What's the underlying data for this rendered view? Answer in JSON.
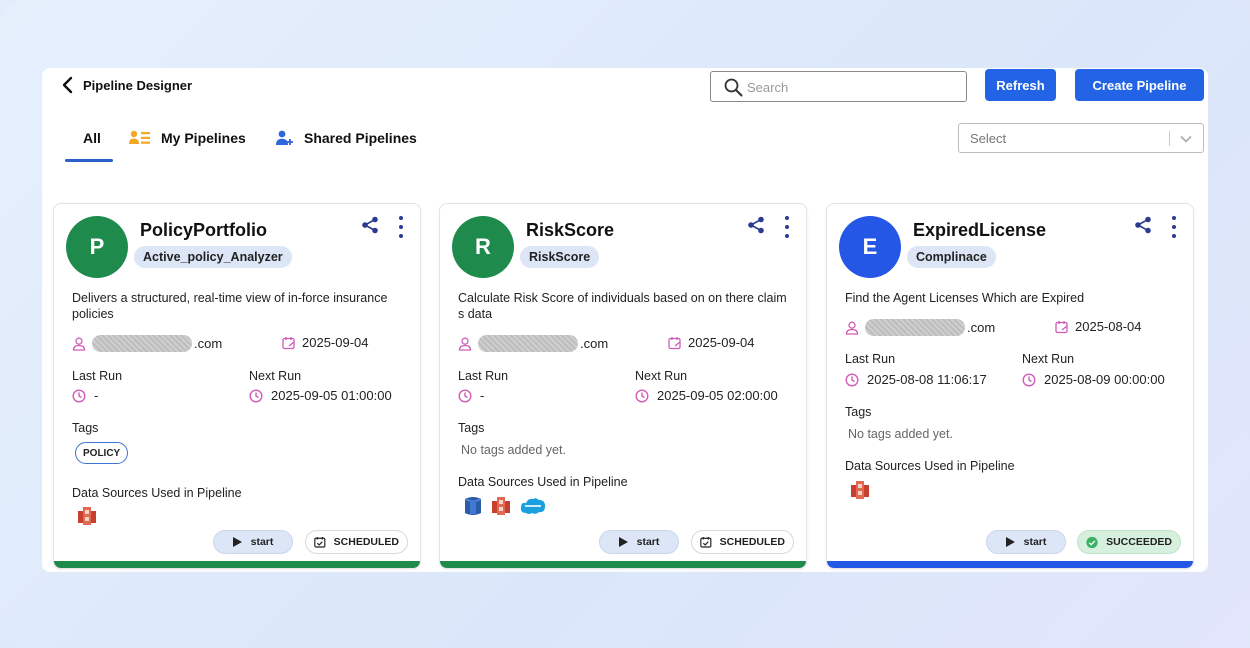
{
  "header": {
    "title": "Pipeline Designer",
    "search_placeholder": "Search",
    "refresh_label": "Refresh",
    "create_label": "Create Pipeline"
  },
  "tabs": {
    "all": "All",
    "my": "My Pipelines",
    "shared": "Shared Pipelines"
  },
  "filter": {
    "placeholder": "Select"
  },
  "labels": {
    "last_run": "Last Run",
    "next_run": "Next Run",
    "tags": "Tags",
    "no_tags": "No tags added yet.",
    "data_sources": "Data Sources Used in Pipeline",
    "start": "start",
    "owner_suffix": ".com"
  },
  "colors": {
    "primary": "#2264e5",
    "green": "#1e8a4c",
    "blue": "#2457e6",
    "icon_pink": "#d05bb8"
  },
  "cards": [
    {
      "initial": "P",
      "name": "PolicyPortfolio",
      "chip": "Active_policy_Analyzer",
      "description": "Delivers a structured, real-time view of in-force insurance policies",
      "created": "2025-09-04",
      "last_run": "-",
      "next_run": "2025-09-05 01:00:00",
      "tags": [
        "POLICY"
      ],
      "data_sources": [
        "redshift-icon"
      ],
      "status": "SCHEDULED"
    },
    {
      "initial": "R",
      "name": "RiskScore",
      "chip": "RiskScore",
      "description": "Calculate Risk Score of individuals based on on there claim s data",
      "created": "2025-09-04",
      "last_run": "-",
      "next_run": "2025-09-05 02:00:00",
      "tags": [],
      "data_sources": [
        "rds-database-icon",
        "redshift-icon",
        "salesforce-icon"
      ],
      "status": "SCHEDULED"
    },
    {
      "initial": "E",
      "name": "ExpiredLicense",
      "chip": "Complinace",
      "description": "Find the Agent Licenses Which are Expired",
      "created": "2025-08-04",
      "last_run": "2025-08-08 11:06:17",
      "next_run": "2025-08-09 00:00:00",
      "tags": [],
      "data_sources": [
        "redshift-icon"
      ],
      "status": "SUCCEEDED"
    }
  ]
}
